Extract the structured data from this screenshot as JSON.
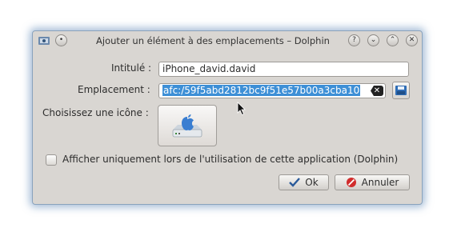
{
  "dialog": {
    "title": "Ajouter un élément à des emplacements – Dolphin",
    "title_buttons": [
      "help-icon",
      "minimize-icon",
      "maximize-icon",
      "close-icon"
    ]
  },
  "form": {
    "name_label": "Intitulé :",
    "name_value": "iPhone_david.david",
    "location_label": "Emplacement :",
    "location_value": "afc:/59f5abd2812bc9f51e57b00a3cba10",
    "icon_label": "Choisissez une icône :",
    "checkbox_label": "Afficher uniquement lors de l'utilisation de cette application (Dolphin)",
    "checkbox_checked": false
  },
  "buttons": {
    "ok_label": "Ok",
    "cancel_label": "Annuler"
  },
  "colors": {
    "selection": "#3d8fd6",
    "window_bg": "#d9d6d2",
    "glow": "#5884b4"
  }
}
